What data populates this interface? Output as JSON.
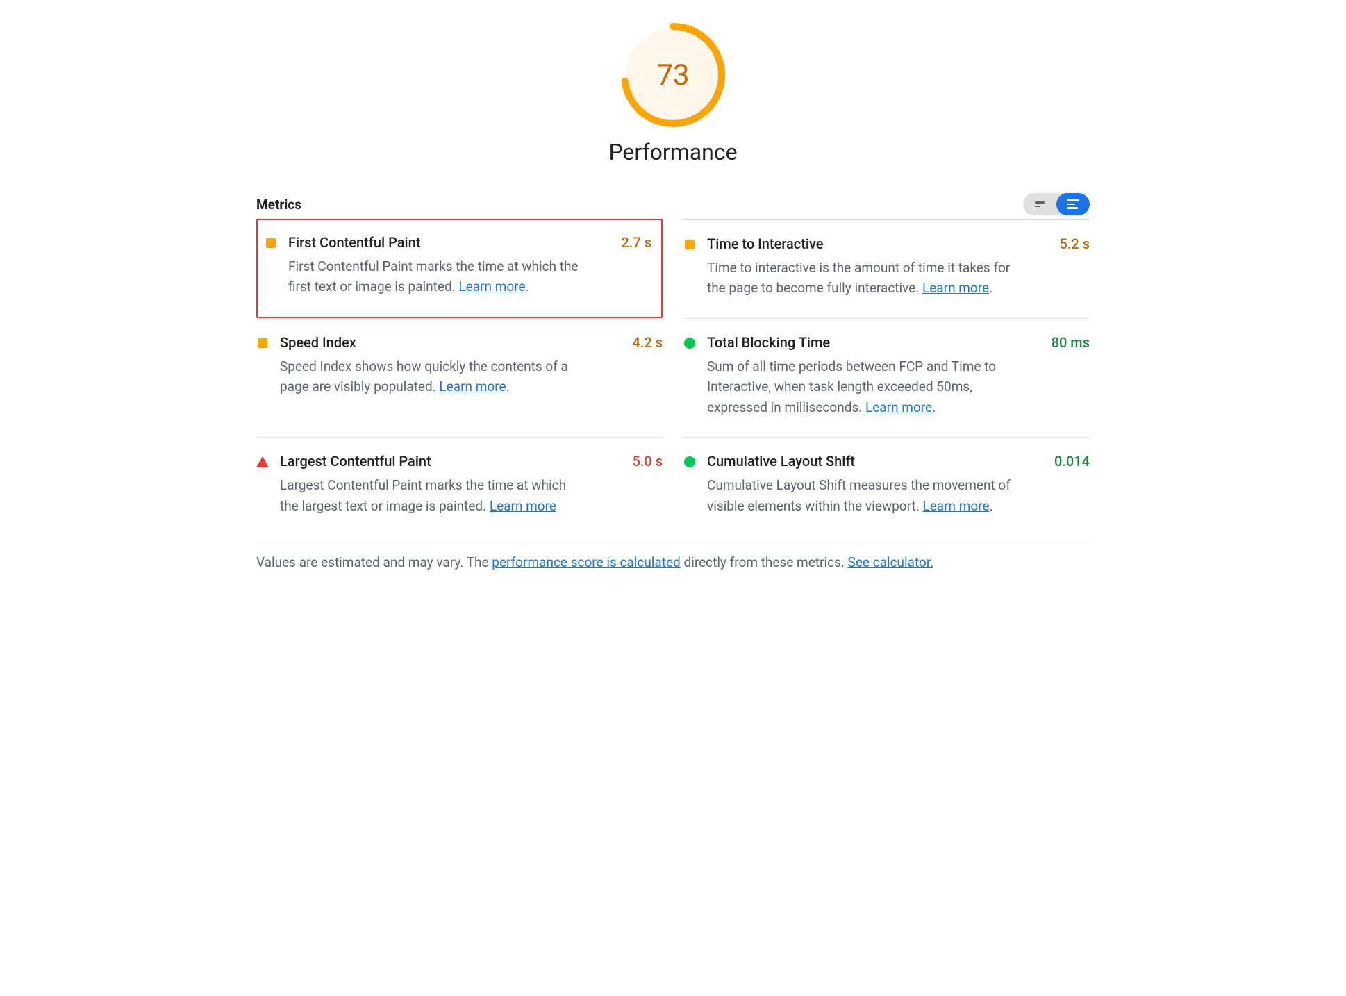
{
  "gauge": {
    "score": 73,
    "percent": 0.73
  },
  "category_title": "Performance",
  "metrics_label": "Metrics",
  "learn_more_text": "Learn more",
  "metrics": [
    {
      "id": "fcp",
      "icon": "square-orange",
      "title": "First Contentful Paint",
      "value": "2.7 s",
      "value_class": "v-avg",
      "desc_pre": "First Contentful Paint marks the time at which the first text or image is painted. ",
      "desc_post": ".",
      "highlighted": true
    },
    {
      "id": "tti",
      "icon": "square-orange",
      "title": "Time to Interactive",
      "value": "5.2 s",
      "value_class": "v-avg",
      "desc_pre": "Time to interactive is the amount of time it takes for the page to become fully interactive. ",
      "desc_post": ".",
      "highlighted": false
    },
    {
      "id": "si",
      "icon": "square-orange",
      "title": "Speed Index",
      "value": "4.2 s",
      "value_class": "v-avg",
      "desc_pre": "Speed Index shows how quickly the contents of a page are visibly populated. ",
      "desc_post": ".",
      "highlighted": false
    },
    {
      "id": "tbt",
      "icon": "circle-green",
      "title": "Total Blocking Time",
      "value": "80 ms",
      "value_class": "v-pass",
      "desc_pre": "Sum of all time periods between FCP and Time to Interactive, when task length exceeded 50ms, expressed in milliseconds. ",
      "desc_post": ".",
      "highlighted": false
    },
    {
      "id": "lcp",
      "icon": "triangle-red",
      "title": "Largest Contentful Paint",
      "value": "5.0 s",
      "value_class": "v-fail",
      "desc_pre": "Largest Contentful Paint marks the time at which the largest text or image is painted. ",
      "desc_post": "",
      "highlighted": false
    },
    {
      "id": "cls",
      "icon": "circle-green",
      "title": "Cumulative Layout Shift",
      "value": "0.014",
      "value_class": "v-pass",
      "desc_pre": "Cumulative Layout Shift measures the movement of visible elements within the viewport. ",
      "desc_post": ".",
      "highlighted": false
    }
  ],
  "footnote": {
    "pre": "Values are estimated and may vary. The ",
    "link1": "performance score is calculated",
    "mid": " directly from these metrics. ",
    "link2": "See calculator."
  },
  "colors": {
    "orange": "#FFA400",
    "blue": "#1A73E8",
    "red": "#E53935",
    "green_dark": "#168A3C",
    "green_bright": "#00C853",
    "amber_text": "#C96500"
  }
}
